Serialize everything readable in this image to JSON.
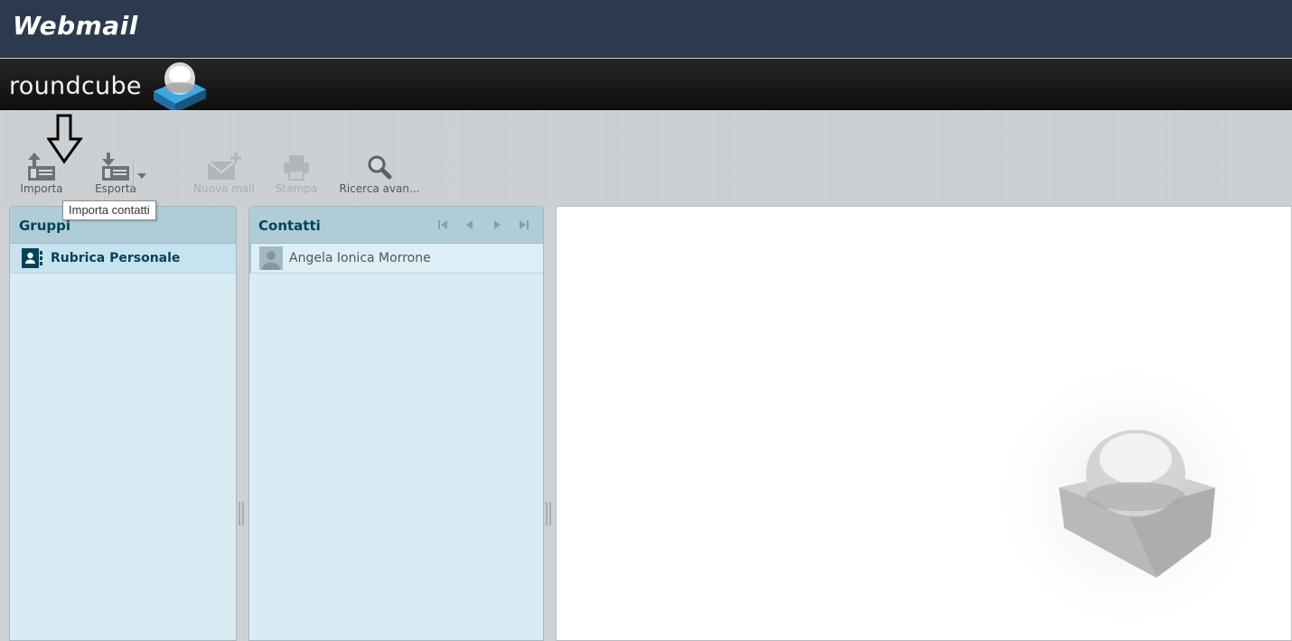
{
  "topbar": {
    "brand": "Webmail"
  },
  "header": {
    "logo_text": "roundcube"
  },
  "toolbar": {
    "import_label": "Importa",
    "export_label": "Esporta",
    "compose_label": "Nuova mail",
    "print_label": "Stampa",
    "search_label": "Ricerca avan..."
  },
  "tooltip": {
    "text": "Importa contatti"
  },
  "groups": {
    "title": "Gruppi",
    "items": [
      {
        "label": "Rubrica Personale"
      }
    ]
  },
  "contacts": {
    "title": "Contatti",
    "items": [
      {
        "name": "Angela Ionica Morrone"
      }
    ]
  },
  "colors": {
    "topbar": "#2b3b4d",
    "panel_header": "#b0ccd7",
    "panel_body": "#d9ebf3",
    "accent_text": "#004458"
  }
}
